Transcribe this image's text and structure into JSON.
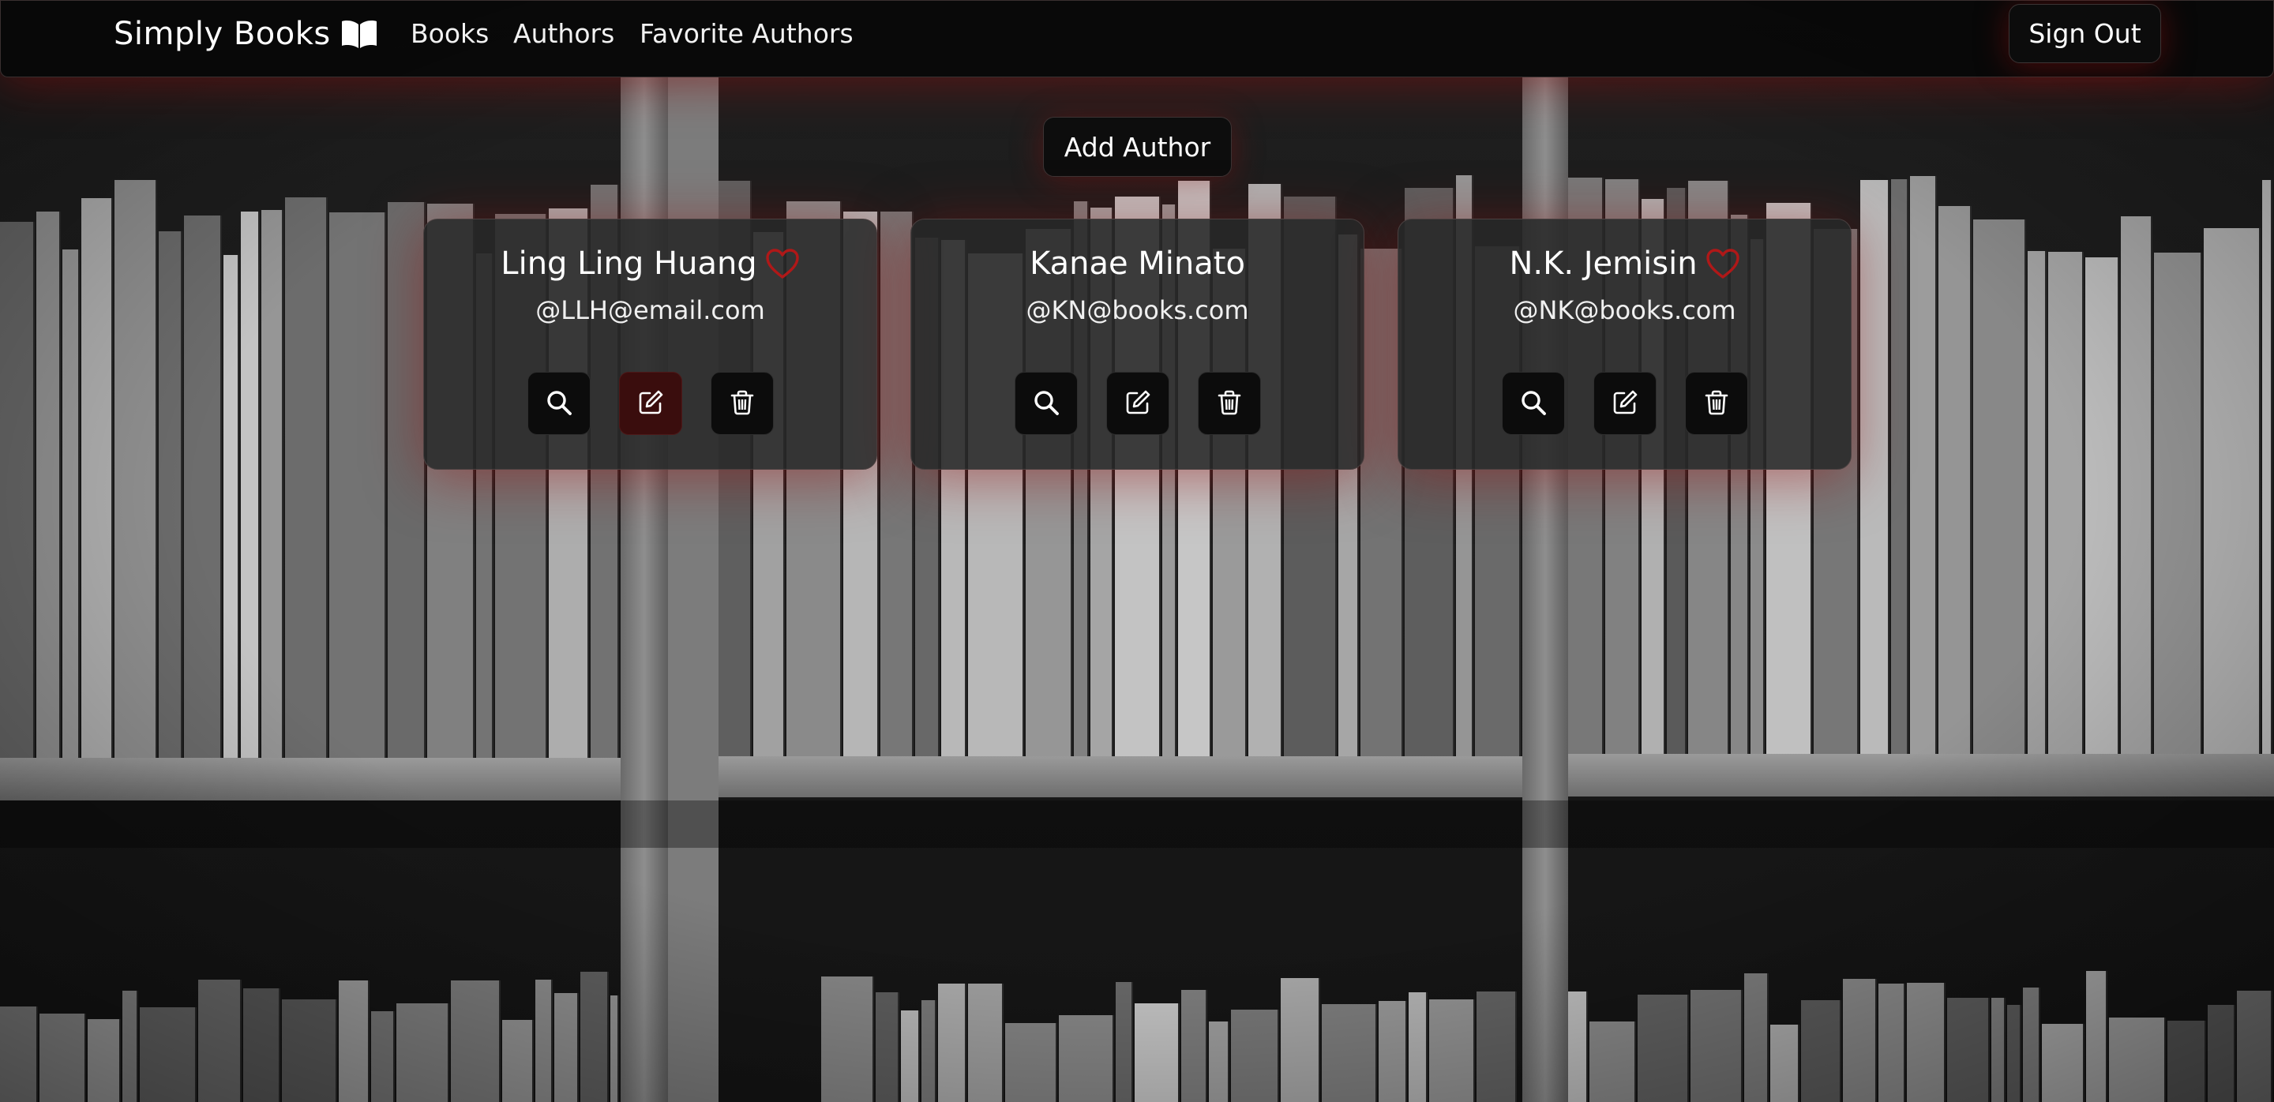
{
  "navbar": {
    "brand": "Simply Books",
    "links": [
      "Books",
      "Authors",
      "Favorite Authors"
    ],
    "sign_out": "Sign Out"
  },
  "actions": {
    "add_author": "Add Author"
  },
  "authors": [
    {
      "name": "Ling Ling Huang",
      "email": "@LLH@email.com",
      "favorite": true
    },
    {
      "name": "Kanae Minato",
      "email": "@KN@books.com",
      "favorite": false
    },
    {
      "name": "N.K. Jemisin",
      "email": "@NK@books.com",
      "favorite": true
    }
  ],
  "icons": {
    "brand": "open-book-icon",
    "favorite": "heart-outline-icon",
    "view": "search-icon",
    "edit": "pencil-square-icon",
    "delete": "trash-icon"
  },
  "colors": {
    "accent_red": "#b01818",
    "navbar_bg": "#080808",
    "card_bg": "#282828",
    "button_bg": "#0c0c0c"
  }
}
